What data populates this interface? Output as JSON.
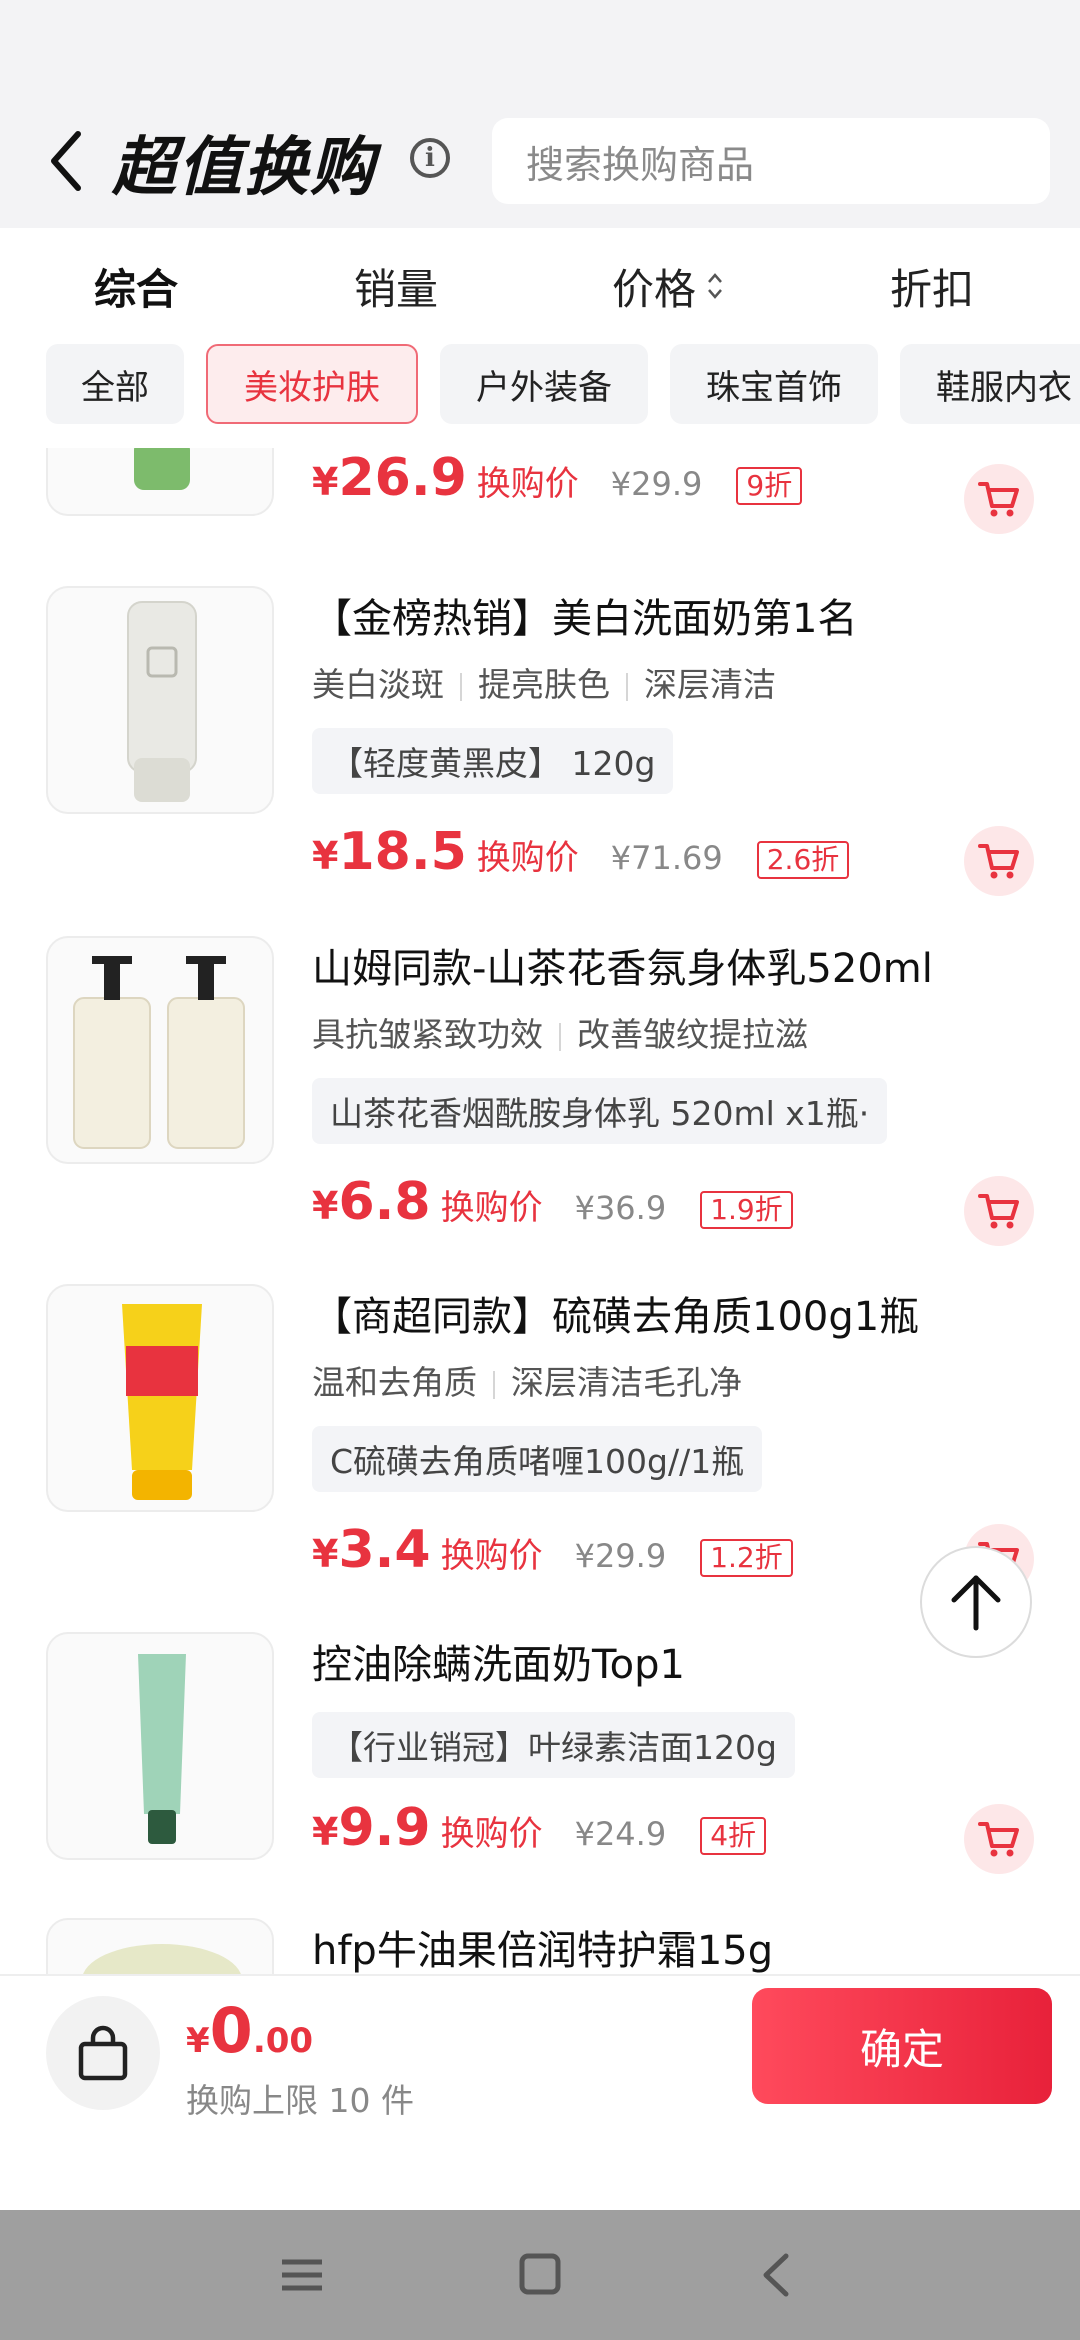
{
  "header": {
    "title": "超值换购",
    "search_placeholder": "搜索换购商品"
  },
  "sort_tabs": [
    "综合",
    "销量",
    "价格",
    "折扣"
  ],
  "categories": [
    "全部",
    "美妆护肤",
    "户外装备",
    "珠宝首饰",
    "鞋服内衣"
  ],
  "active_category": "美妆护肤",
  "products": [
    {
      "title": "",
      "price": "26.9",
      "price_label": "换购价",
      "original_price": "¥29.9",
      "discount": "9折"
    },
    {
      "title": "【金榜热销】美白洗面奶第1名",
      "tags": [
        "美白淡斑",
        "提亮肤色",
        "深层清洁"
      ],
      "spec": "【轻度黄黑皮】 120g",
      "price": "18.5",
      "price_label": "换购价",
      "original_price": "¥71.69",
      "discount": "2.6折"
    },
    {
      "title": "山姆同款-山茶花香氛身体乳520ml",
      "tags": [
        "具抗皱紧致功效",
        "改善皱纹提拉滋"
      ],
      "spec": "山茶花香烟酰胺身体乳 520ml x1瓶·",
      "price": "6.8",
      "price_label": "换购价",
      "original_price": "¥36.9",
      "discount": "1.9折"
    },
    {
      "title": "【商超同款】硫磺去角质100g1瓶",
      "tags": [
        "温和去角质",
        "深层清洁毛孔净"
      ],
      "spec": "C硫磺去角质啫喱100g//1瓶",
      "price": "3.4",
      "price_label": "换购价",
      "original_price": "¥29.9",
      "discount": "1.2折"
    },
    {
      "title": "控油除螨洗面奶Top1",
      "spec": "【行业销冠】叶绿素洁面120g",
      "price": "9.9",
      "price_label": "换购价",
      "original_price": "¥24.9",
      "discount": "4折"
    },
    {
      "title": "hfp牛油果倍润特护霜15g"
    }
  ],
  "currency": "¥",
  "footer": {
    "total_currency": "¥",
    "total_int": "0",
    "total_dec": ".00",
    "limit_text": "换购上限 10 件",
    "confirm_label": "确定"
  },
  "colors": {
    "accent": "#e8333f",
    "header_bg": "#f3f3f5",
    "nav_bar": "#9f9f9f"
  }
}
